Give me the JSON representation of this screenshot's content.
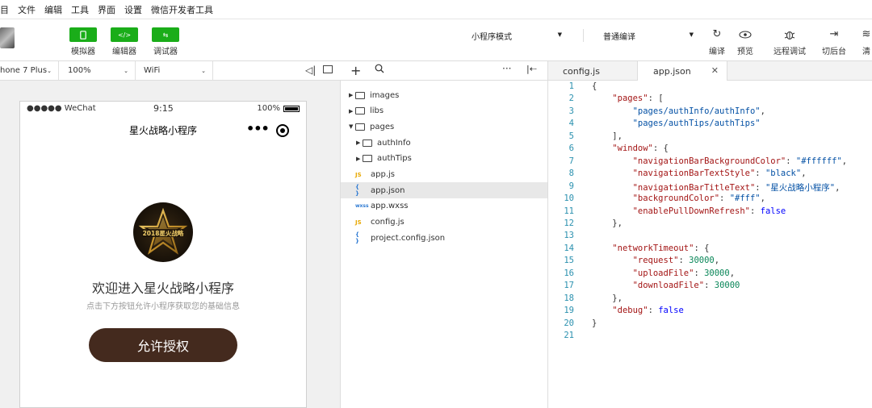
{
  "menubar": {
    "items": [
      "目",
      "文件",
      "编辑",
      "工具",
      "界面",
      "设置",
      "微信开发者工具"
    ]
  },
  "toolbar": {
    "simulator_label": "模拟器",
    "editor_label": "编辑器",
    "debugger_label": "调试器",
    "mode_select": "小程序模式",
    "compile_select": "普通编译",
    "compile_label": "编译",
    "preview_label": "预览",
    "remote_debug_label": "远程调试",
    "background_label": "切后台",
    "clear_label": "清"
  },
  "simheader": {
    "device": "hone 7 Plus",
    "zoom": "100%",
    "network": "WiFi"
  },
  "phone": {
    "carrier": "●●●●● WeChat",
    "time": "9:15",
    "battery": "100%",
    "nav_title": "星火战略小程序",
    "nav_dots": "•••",
    "logo_text": "2018星火战略",
    "welcome": "欢迎进入星火战略小程序",
    "subtitle": "点击下方按钮允许小程序获取您的基础信息",
    "auth_button": "允许授权"
  },
  "filetree": {
    "items": [
      {
        "type": "folder",
        "name": "images",
        "expanded": false,
        "depth": 0
      },
      {
        "type": "folder",
        "name": "libs",
        "expanded": false,
        "depth": 0
      },
      {
        "type": "folder",
        "name": "pages",
        "expanded": true,
        "depth": 0
      },
      {
        "type": "folder",
        "name": "authInfo",
        "expanded": false,
        "depth": 1
      },
      {
        "type": "folder",
        "name": "authTips",
        "expanded": false,
        "depth": 1
      },
      {
        "type": "js",
        "name": "app.js",
        "depth": 0
      },
      {
        "type": "json",
        "name": "app.json",
        "depth": 0,
        "selected": true
      },
      {
        "type": "wxss",
        "name": "app.wxss",
        "depth": 0
      },
      {
        "type": "js",
        "name": "config.js",
        "depth": 0
      },
      {
        "type": "json",
        "name": "project.config.json",
        "depth": 0
      }
    ]
  },
  "editor": {
    "tabs": [
      {
        "label": "config.js",
        "active": false
      },
      {
        "label": "app.json",
        "active": true
      }
    ],
    "lines": [
      "{",
      "    \"pages\": [",
      "        \"pages/authInfo/authInfo\",",
      "        \"pages/authTips/authTips\"",
      "    ],",
      "    \"window\": {",
      "        \"navigationBarBackgroundColor\": \"#ffffff\",",
      "        \"navigationBarTextStyle\": \"black\",",
      "        \"navigationBarTitleText\": \"星火战略小程序\",",
      "        \"backgroundColor\": \"#fff\",",
      "        \"enablePullDownRefresh\": false",
      "    },",
      "",
      "    \"networkTimeout\": {",
      "        \"request\": 30000,",
      "        \"uploadFile\": 30000,",
      "        \"downloadFile\": 30000",
      "    },",
      "    \"debug\": false",
      "}",
      ""
    ]
  },
  "colors": {
    "accent_green": "#1aad19",
    "auth_button": "#442a1e"
  }
}
